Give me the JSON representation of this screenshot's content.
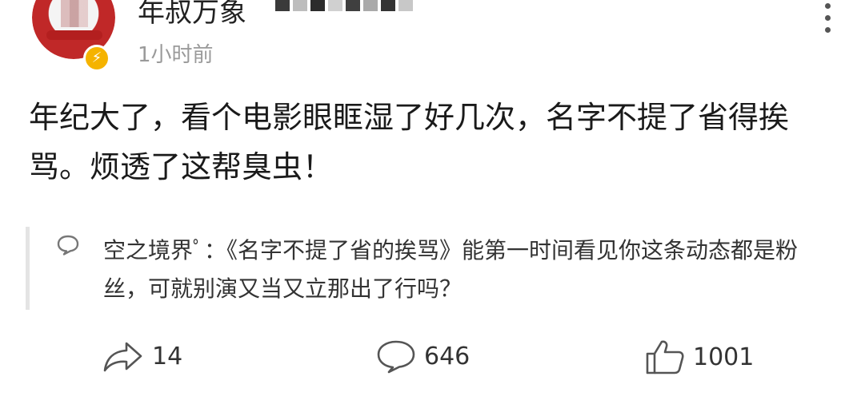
{
  "post": {
    "author": {
      "name": "年叔万象",
      "avatar_icon": "avatar-image",
      "badge_icon": "verified-lightning-icon",
      "badge_color": "#f5b300"
    },
    "time": "1小时前",
    "text": "年纪大了，看个电影眼眶湿了好几次，名字不提了省得挨骂。烦透了这帮臭虫！"
  },
  "quoted_comment": {
    "icon": "comment-bubble-icon",
    "user": "空之境界ﾟ",
    "text": "：《名字不提了省的挨骂》能第一时间看见你这条动态都是粉丝，可就别演又当又立那出了行吗？"
  },
  "actions": {
    "share": {
      "icon": "share-icon",
      "count": "14"
    },
    "comment": {
      "icon": "comment-icon",
      "count": "646"
    },
    "like": {
      "icon": "thumbs-up-icon",
      "count": "1001"
    }
  },
  "menu": {
    "icon": "more-vertical-icon"
  }
}
